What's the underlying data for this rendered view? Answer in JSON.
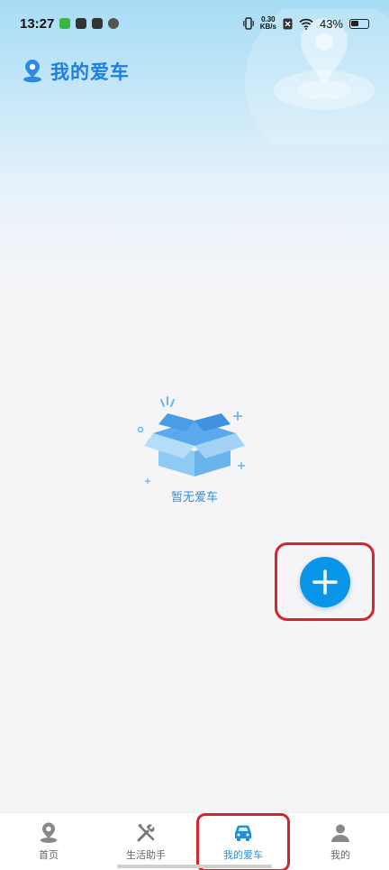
{
  "status_bar": {
    "time": "13:27",
    "net_speed_value": "0.30",
    "net_speed_unit": "KB/s",
    "battery": "43%"
  },
  "header": {
    "title": "我的爱车",
    "icon": "location-pin-icon"
  },
  "empty_state": {
    "icon": "empty-box-icon",
    "text": "暂无爱车"
  },
  "fab": {
    "icon": "plus-icon",
    "color": "#0a96e8"
  },
  "bottom_nav": {
    "items": [
      {
        "label": "首页",
        "icon": "location-pin-icon",
        "active": false
      },
      {
        "label": "生活助手",
        "icon": "tools-icon",
        "active": false
      },
      {
        "label": "我的爱车",
        "icon": "car-icon",
        "active": true
      },
      {
        "label": "我的",
        "icon": "person-icon",
        "active": false
      }
    ]
  },
  "colors": {
    "accent": "#1f90e0",
    "highlight": "#d6242c"
  }
}
